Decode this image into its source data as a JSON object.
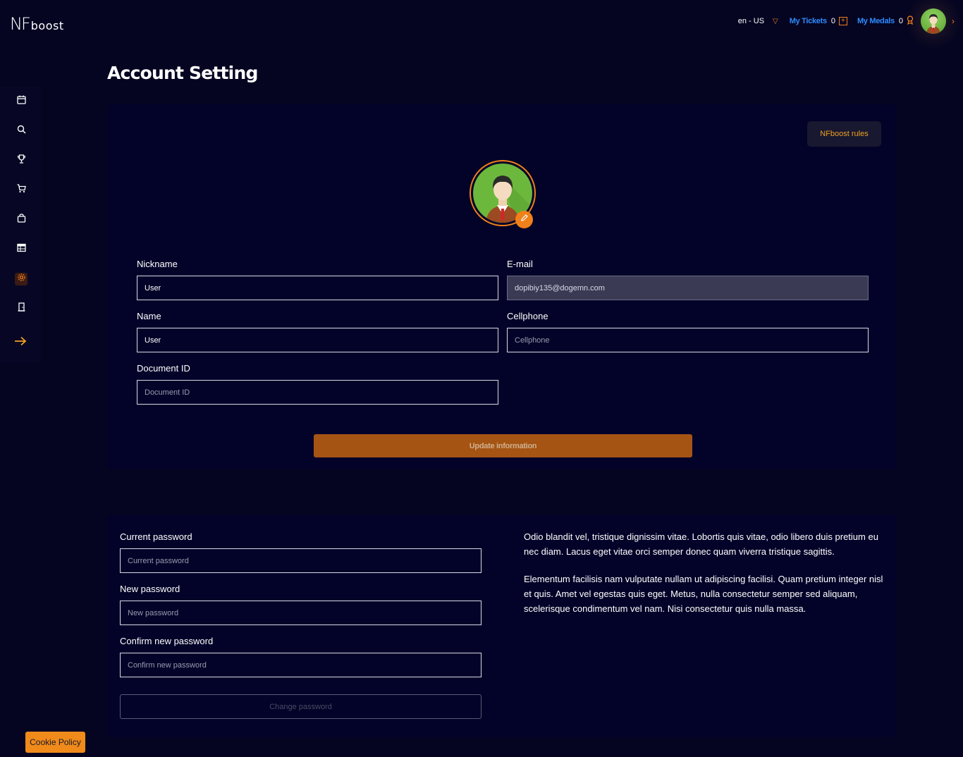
{
  "brand": {
    "logo_nf": "NF",
    "logo_boost": "boost"
  },
  "topbar": {
    "language": "en - US",
    "tickets_label": "My Tickets",
    "tickets_count": "0",
    "medals_label": "My Medals",
    "medals_count": "0"
  },
  "sidebar": {
    "items": [
      {
        "name": "calendar",
        "icon": "calendar-icon"
      },
      {
        "name": "search",
        "icon": "search-icon"
      },
      {
        "name": "trophy",
        "icon": "trophy-icon"
      },
      {
        "name": "cart",
        "icon": "cart-icon"
      },
      {
        "name": "bag",
        "icon": "shopping-bag-icon"
      },
      {
        "name": "table",
        "icon": "table-icon"
      },
      {
        "name": "settings",
        "icon": "gear-icon",
        "active": true
      },
      {
        "name": "logout",
        "icon": "door-icon"
      }
    ],
    "expand_icon": "arrow-right-icon"
  },
  "page": {
    "title": "Account Setting"
  },
  "profile": {
    "rules_label": "NFboost rules",
    "fields": {
      "nickname": {
        "label": "Nickname",
        "value": "User"
      },
      "email": {
        "label": "E-mail",
        "value": "dopibiy135@dogemn.com"
      },
      "name": {
        "label": "Name",
        "value": "User"
      },
      "cellphone": {
        "label": "Cellphone",
        "placeholder": "Cellphone"
      },
      "document": {
        "label": "Document ID",
        "placeholder": "Document ID"
      }
    },
    "update_label": "Update information"
  },
  "password": {
    "current": {
      "label": "Current password",
      "placeholder": "Current password"
    },
    "new": {
      "label": "New password",
      "placeholder": "New password"
    },
    "confirm": {
      "label": "Confirm new password",
      "placeholder": "Confirm new password"
    },
    "change_label": "Change password",
    "paragraph1": "Odio blandit vel, tristique dignissim vitae. Lobortis quis vitae, odio libero duis pretium eu nec diam. Lacus eget vitae orci semper donec quam viverra tristique sagittis.",
    "paragraph2": "Elementum facilisis nam vulputate nullam ut adipiscing facilisi. Quam pretium integer nisl et quis. Amet vel egestas quis eget. Metus, nulla consectetur semper sed aliquam, scelerisque condimentum vel nam. Nisi consectetur quis nulla massa."
  },
  "cookie": {
    "label": "Cookie Policy"
  },
  "colors": {
    "accent": "#f0801a",
    "link": "#2f8cff",
    "background": "#050522"
  }
}
